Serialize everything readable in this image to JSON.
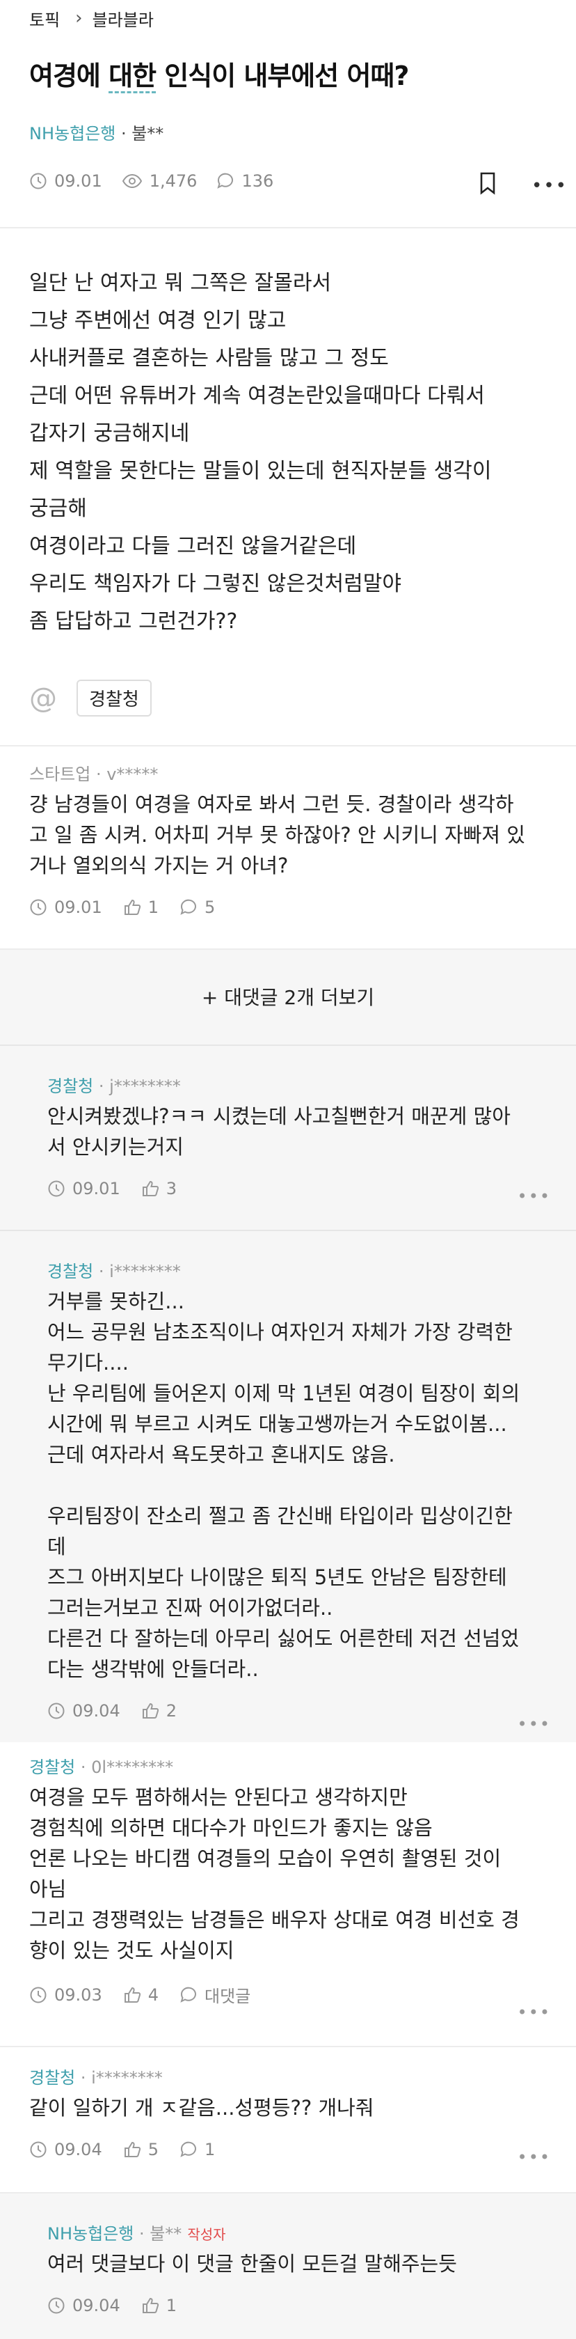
{
  "breadcrumb": {
    "section": "토픽",
    "board": "블라블라"
  },
  "post": {
    "title_pre": "여경에 ",
    "title_underlined": "대한",
    "title_post": " 인식이 내부에선 어때?",
    "author_company": "NH농협은행",
    "author_sep": " · ",
    "author_name": "불**",
    "date": "09.01",
    "views": "1,476",
    "comments": "136",
    "body": [
      "일단 난 여자고 뭐 그쪽은 잘몰라서",
      "그냥 주변에선 여경 인기 많고",
      "사내커플로 결혼하는 사람들 많고 그 정도",
      "근데 어떤 유튜버가 계속 여경논란있을때마다 다뤄서",
      "갑자기 궁금해지네",
      "제 역할을 못한다는 말들이 있는데 현직자분들 생각이",
      "궁금해",
      "여경이라고 다들 그러진 않을거같은데",
      "우리도 책임자가 다 그렇진 않은것처럼말야",
      "좀 답답하고 그런건가??"
    ],
    "tag": "경찰청"
  },
  "comments": [
    {
      "company": "스타트업",
      "name": "v*****",
      "lines": [
        "걍 남경들이 여경을 여자로 봐서 그런 듯. 경찰이라 생각하",
        "고 일 좀 시켜. 어차피 거부 못 하잖아? 안 시키니 자빠져 있",
        "거나 열외의식 가지는 거 아녀?"
      ],
      "date": "09.01",
      "likes": "1",
      "replies": "5"
    }
  ],
  "more_replies": "+ 대댓글 2개 더보기",
  "replies": [
    {
      "company": "경찰청",
      "name": "j********",
      "lines": [
        "안시켜봤겠냐?ㅋㅋ 시켰는데 사고칠뻔한거 매꾼게 많아",
        "서 안시키는거지"
      ],
      "date": "09.01",
      "likes": "3"
    },
    {
      "company": "경찰청",
      "name": "i********",
      "lines": [
        "거부를 못하긴...",
        "어느 공무원 남초조직이나 여자인거 자체가 가장 강력한",
        "무기다....",
        "난 우리팀에 들어온지 이제 막 1년된 여경이 팀장이 회의",
        "시간에 뭐 부르고 시켜도 대놓고쌩까는거 수도없이봄...",
        "근데 여자라서 욕도못하고 혼내지도 않음.",
        "",
        "우리팀장이 잔소리 쩔고 좀 간신배 타입이라 밉상이긴한",
        "데",
        "즈그 아버지보다 나이많은 퇴직 5년도 안남은 팀장한테",
        "그러는거보고 진짜 어이가없더라..",
        "다른건 다 잘하는데 아무리 싫어도 어른한테 저건 선넘었",
        "다는 생각밖에 안들더라.."
      ],
      "date": "09.04",
      "likes": "2"
    }
  ],
  "comments2": [
    {
      "company": "경찰청",
      "name": "0l********",
      "lines": [
        "여경을 모두 폄하해서는 안된다고 생각하지만",
        "경험칙에 의하면 대다수가 마인드가 좋지는 않음",
        "언론 나오는 바디캠 여경들의 모습이 우연히 촬영된 것이",
        "아님",
        "그리고 경쟁력있는 남경들은 배우자 상대로 여경 비선호 경",
        "향이 있는 것도 사실이지"
      ],
      "date": "09.03",
      "likes": "4",
      "reply_label": "대댓글"
    },
    {
      "company": "경찰청",
      "name": "i********",
      "lines": [
        "같이 일하기 개 ㅈ같음...성평등?? 개나줘"
      ],
      "date": "09.04",
      "likes": "5",
      "replies": "1"
    }
  ],
  "last_reply": {
    "company": "NH농협은행",
    "name": "불**",
    "badge": "작성자",
    "lines": [
      "여러 댓글보다 이 댓글 한줄이 모든걸 말해주는듯"
    ],
    "date": "09.04",
    "likes": "1"
  },
  "colors": {
    "accent": "#3f9fac",
    "badge": "#e24b4b",
    "muted": "#888888",
    "gray_bg": "#f6f6f6"
  }
}
